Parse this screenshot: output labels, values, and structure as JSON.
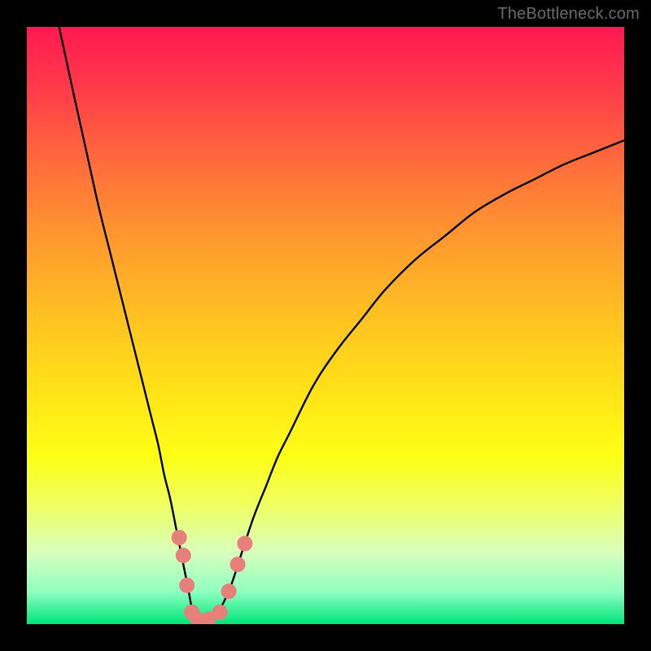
{
  "watermark": "TheBottleneck.com",
  "colors": {
    "frame": "#000000",
    "gradient_top": "#ff1951",
    "gradient_bottom": "#00e47a",
    "curve": "#000000",
    "marker": "#e77f7b",
    "watermark_text": "#6a6a6a"
  },
  "chart_data": {
    "type": "line",
    "title": "",
    "xlabel": "",
    "ylabel": "",
    "xlim": [
      0,
      100
    ],
    "ylim": [
      0,
      100
    ],
    "grid": false,
    "legend": false,
    "note": "Two V-shaped bottleneck curves over a red→green vertical gradient. Y ≈ bottleneck severity (100 at top/red, 0 at bottom/green). X is a normalized parameter. Left branch drops steeply to ~0 near x≈28, right branch rises more gradually. Values read off pixel positions.",
    "series": [
      {
        "name": "left-branch",
        "x": [
          5.4,
          8,
          10,
          12,
          14,
          16,
          18,
          20,
          21,
          22,
          23,
          24,
          25,
          26,
          27,
          28,
          29
        ],
        "y": [
          100,
          88,
          79,
          70,
          62,
          54,
          46,
          38,
          34,
          30,
          25,
          21,
          16,
          11,
          6,
          1,
          0
        ]
      },
      {
        "name": "right-branch",
        "x": [
          30,
          32,
          34,
          36,
          38,
          40,
          42,
          44,
          48,
          52,
          56,
          60,
          65,
          70,
          75,
          80,
          85,
          90,
          95,
          100
        ],
        "y": [
          0,
          2,
          6,
          12,
          18,
          23,
          28,
          32,
          40,
          46,
          51,
          56,
          61,
          65,
          69,
          72,
          74.5,
          77,
          79,
          81
        ]
      }
    ],
    "markers": {
      "name": "highlighted-points",
      "color": "#e77f7b",
      "points": [
        {
          "x": 25.5,
          "y": 14.5
        },
        {
          "x": 26.2,
          "y": 11.5
        },
        {
          "x": 26.8,
          "y": 6.5
        },
        {
          "x": 27.6,
          "y": 2
        },
        {
          "x": 28.6,
          "y": 0.8
        },
        {
          "x": 30.4,
          "y": 0.8
        },
        {
          "x": 32.3,
          "y": 2
        },
        {
          "x": 33.8,
          "y": 5.5
        },
        {
          "x": 35.3,
          "y": 10
        },
        {
          "x": 36.5,
          "y": 13.5
        }
      ]
    }
  }
}
